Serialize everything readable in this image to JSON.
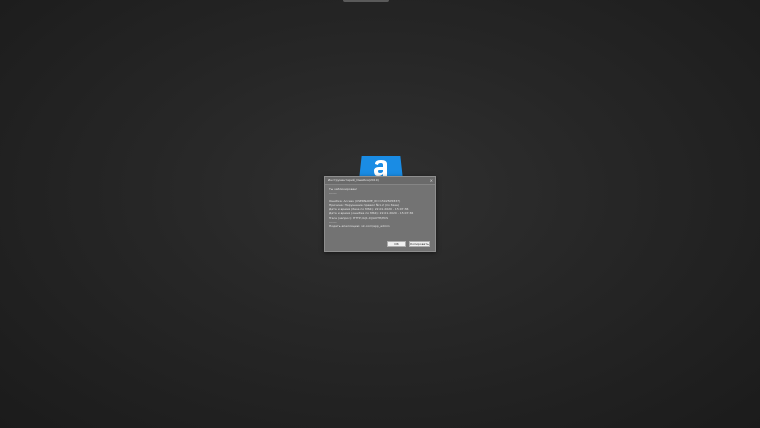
{
  "dialog": {
    "title": "Инструментарий_Ошибка(2019)",
    "close_glyph": "×",
    "lines": [
      "Ты заблокирован!",
      "-------",
      "Ошибка: Access (USERNAME_ID=1592505837)",
      "Причина: Нарушение правил №1.2 (по базе)",
      "Дата и время (база по MSK): 22.01.2020 - 15:07:36",
      "Дата и время (ошибка по MSK): 22.01.2020 - 15:07:36",
      "Trace (запрос): HTTP:/A(1.0)/AUTH/PCS",
      "-------",
      "Подать апелляцию: vk.com/app_admin"
    ],
    "ok_label": "ОК",
    "copy_label": "Копировать"
  },
  "icons": {
    "logo": "app-logo-icon",
    "close": "close-icon"
  },
  "colors": {
    "logo_blue": "#1a8ce4",
    "dialog_bg": "#737373"
  }
}
